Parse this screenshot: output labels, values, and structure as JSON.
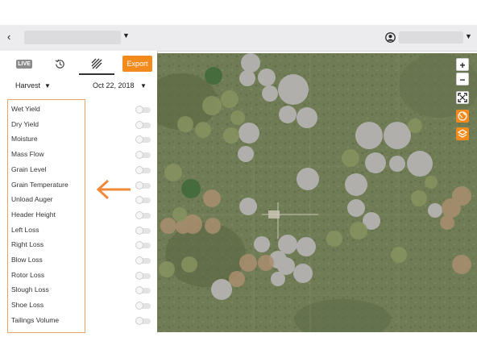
{
  "header": {
    "back_icon": "chevron-left-icon",
    "user_icon": "user-circle-icon"
  },
  "panel": {
    "tabs": {
      "live_label": "LIVE",
      "history_icon": "history-icon",
      "heatmap_icon": "heatmap-icon"
    },
    "export_label": "Export",
    "operation_select": "Harvest",
    "date_select": "Oct 22, 2018",
    "layers": [
      {
        "label": "Wet Yield",
        "enabled": false
      },
      {
        "label": "Dry Yield",
        "enabled": false
      },
      {
        "label": "Moisture",
        "enabled": false
      },
      {
        "label": "Mass Flow",
        "enabled": false
      },
      {
        "label": "Grain Level",
        "enabled": false
      },
      {
        "label": "Grain Temperature",
        "enabled": false
      },
      {
        "label": "Unload Auger",
        "enabled": false
      },
      {
        "label": "Header Height",
        "enabled": false
      },
      {
        "label": "Left Loss",
        "enabled": false
      },
      {
        "label": "Right Loss",
        "enabled": false
      },
      {
        "label": "Blow Loss",
        "enabled": false
      },
      {
        "label": "Rotor Loss",
        "enabled": false
      },
      {
        "label": "Slough Loss",
        "enabled": false
      },
      {
        "label": "Shoe Loss",
        "enabled": false
      },
      {
        "label": "Tailings Volume",
        "enabled": false
      }
    ]
  },
  "map": {
    "zoom_in_label": "+",
    "zoom_out_label": "−",
    "controls": [
      "fullscreen-icon",
      "globe-icon",
      "layers-icon"
    ]
  },
  "colors": {
    "accent": "#f28a1c",
    "highlight_border": "#f0a060"
  }
}
